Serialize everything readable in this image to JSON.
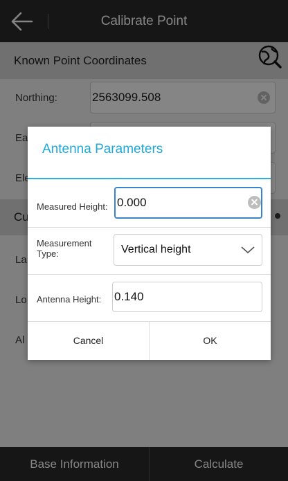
{
  "header": {
    "title": "Calibrate Point",
    "back_icon": "back-arrow-icon"
  },
  "known_point": {
    "section_title": "Known Point Coordinates",
    "globe_icon": "globe-search-icon",
    "rows": [
      {
        "label": "Northing:",
        "value": "2563099.508"
      },
      {
        "label": "Ea",
        "value": ""
      },
      {
        "label": "Ele",
        "value": ""
      }
    ]
  },
  "current_point": {
    "section_title": "Cu",
    "rows": [
      {
        "label": "La"
      },
      {
        "label": "Lo"
      },
      {
        "label": "Al"
      }
    ]
  },
  "bottom_bar": {
    "left_label": "Base Information",
    "right_label": "Calculate"
  },
  "dialog": {
    "title": "Antenna Parameters",
    "measured_height": {
      "label": "Measured Height:",
      "value": "0.000"
    },
    "measurement_type": {
      "label": "Measurement Type:",
      "value": "Vertical height"
    },
    "antenna_height": {
      "label": "Antenna Height:",
      "value": "0.140"
    },
    "cancel_label": "Cancel",
    "ok_label": "OK"
  },
  "colors": {
    "accent": "#1fa8d8",
    "focus_border": "#3b83c8",
    "topbar": "#2b2b2b"
  }
}
